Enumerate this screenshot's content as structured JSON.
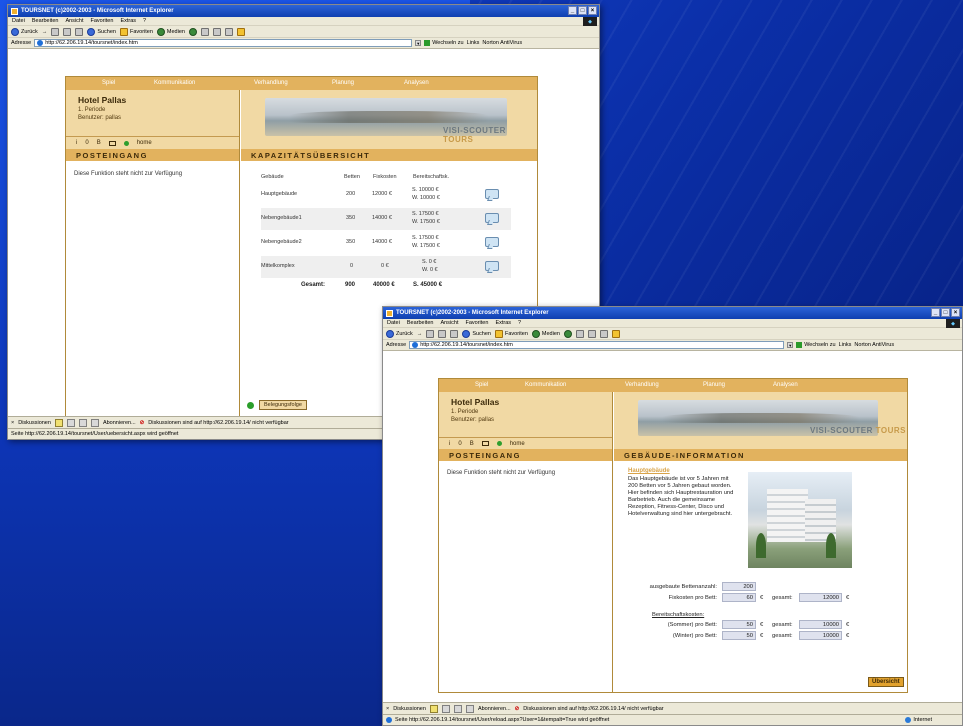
{
  "browser": {
    "title": "TOURSNET (c)2002-2003 - Microsoft Internet Explorer",
    "menu": [
      "Datei",
      "Bearbeiten",
      "Ansicht",
      "Favoriten",
      "Extras",
      "?"
    ],
    "toolbar": {
      "back": "Zurück",
      "search": "Suchen",
      "favorites": "Favoriten",
      "media": "Medien"
    },
    "address_label": "Adresse",
    "address_url": "http://62.206.19.14/toursnet/index.htm",
    "go_label": "Wechseln zu",
    "links_label": "Links",
    "norton_label": "Norton AntiVirus",
    "discussions_label": "Diskussionen",
    "subscribe_label": "Abonnieren...",
    "discussion_msg_1": "Diskussionen sind auf http://62.206.19.14/ nicht verfügbar",
    "discussion_msg_2": "Diskussionen sind auf http://62.206.19.14/ nicht verfügbar"
  },
  "site": {
    "nav": [
      "Spiel",
      "Kommunikation",
      "Verhandlung",
      "Planung",
      "Analysen"
    ],
    "hotel_name": "Hotel Pallas",
    "period": "1. Periode",
    "user": "Benutzer: pallas",
    "iconrow": {
      "i": "i",
      "num": "0",
      "b": "B",
      "home": "home"
    },
    "inbox_title": "POSTEINGANG",
    "inbox_message": "Diese Funktion steht nicht zur Verfügung",
    "brand": {
      "main": "VISI-SCOUTER",
      "accent": "TOURS"
    }
  },
  "window1": {
    "section_title": "KAPAZITÄTSÜBERSICHT",
    "columns": [
      "Gebäude",
      "Betten",
      "Fixkosten",
      "Bereitschaftsk."
    ],
    "rows": [
      {
        "name": "Hauptgebäude",
        "beds": "200",
        "fixed": "12000 €",
        "s": "S. 10000 €",
        "w": "W. 10000 €"
      },
      {
        "name": "Nebengebäude1",
        "beds": "350",
        "fixed": "14000 €",
        "s": "S. 17500 €",
        "w": "W. 17500 €"
      },
      {
        "name": "Nebengebäude2",
        "beds": "350",
        "fixed": "14000 €",
        "s": "S. 17500 €",
        "w": "W. 17500 €"
      },
      {
        "name": "Mittelkomplex",
        "beds": "0",
        "fixed": "0 €",
        "s": "S. 0 €",
        "w": "W. 0 €"
      }
    ],
    "total_label": "Gesamt:",
    "total_beds": "900",
    "total_fixed": "40000 €",
    "total_s": "S. 45000 €",
    "beleg_label": "Belegungsfolge",
    "status_text": "Seite http://62.206.19.14/toursnet/User/uebersicht.aspx wird geöffnet"
  },
  "window2": {
    "section_title": "GEBÄUDE-INFORMATION",
    "building_title": "Hauptgebäude",
    "description": "Das Hauptgebäude ist vor 5 Jahren mit 200 Betten vor 5 Jahren gebaut worden. Hier befinden sich Hauptrestauration und Barbetrieb. Auch die gemeinsame Rezeption, Fitness-Center, Disco und Hotelverwaltung sind hier untergebracht.",
    "beds_label": "ausgebaute Bettenanzahl:",
    "beds_value": "200",
    "fix_label": "Fixkosten pro Bett:",
    "fix_value": "60",
    "fix_total": "12000",
    "total_label": "gesamt:",
    "standby_title": "Bereitschaftskosten:",
    "summer_label": "(Sommer) pro Bett:",
    "summer_value": "50",
    "summer_total": "10000",
    "winter_label": "(Winter) pro Bett:",
    "winter_value": "50",
    "winter_total": "10000",
    "euro": "€",
    "overview_button": "Übersicht",
    "status_text": "Seite http://62.206.19.14/toursnet/User/reload.aspx?User=1&tempalt=True wird geöffnet",
    "zone_label": "Internet"
  }
}
